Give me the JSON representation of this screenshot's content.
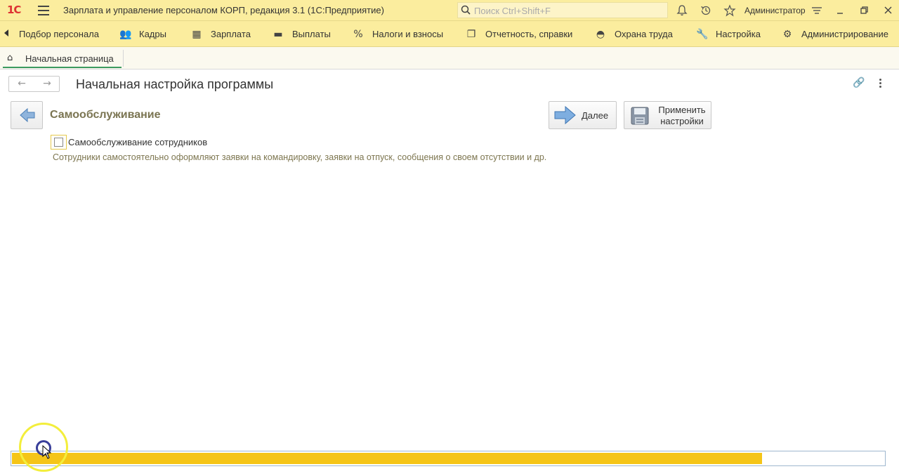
{
  "titlebar": {
    "logo": "1С",
    "app_title": "Зарплата и управление персоналом КОРП, редакция 3.1  (1С:Предприятие)",
    "search_placeholder": "Поиск Ctrl+Shift+F",
    "user": "Администратор",
    "icons": [
      "bell-icon",
      "history-icon",
      "star-icon",
      "settings-icon",
      "minimize-icon",
      "restore-icon",
      "close-icon"
    ]
  },
  "sections": [
    {
      "label": "Подбор персонала",
      "icon": ""
    },
    {
      "label": "Кадры",
      "icon": "people-icon"
    },
    {
      "label": "Зарплата",
      "icon": "calculator-icon"
    },
    {
      "label": "Выплаты",
      "icon": "wallet-icon"
    },
    {
      "label": "Налоги и взносы",
      "icon": "percent-icon"
    },
    {
      "label": "Отчетность, справки",
      "icon": "reports-icon"
    },
    {
      "label": "Охрана труда",
      "icon": "helmet-icon"
    },
    {
      "label": "Настройка",
      "icon": "wrench-icon"
    },
    {
      "label": "Администрирование",
      "icon": "gear-icon"
    }
  ],
  "tabs": {
    "home": "Начальная страница"
  },
  "form": {
    "title": "Начальная настройка программы",
    "section_title": "Самообслуживание",
    "next_button": "Далее",
    "apply_button": "Применить настройки",
    "checkbox_label": "Самообслуживание сотрудников",
    "checkbox_checked": false,
    "hint": "Сотрудники самостоятельно оформляют заявки на командировку, заявки на отпуск, сообщения о своем отсутствии и др."
  },
  "progress": {
    "fraction": 0.86,
    "color": "#f5c518"
  },
  "colors": {
    "titlebar_bg": "#fbed9e",
    "section_title": "#7a7451",
    "progress_fill": "#f5c518"
  }
}
